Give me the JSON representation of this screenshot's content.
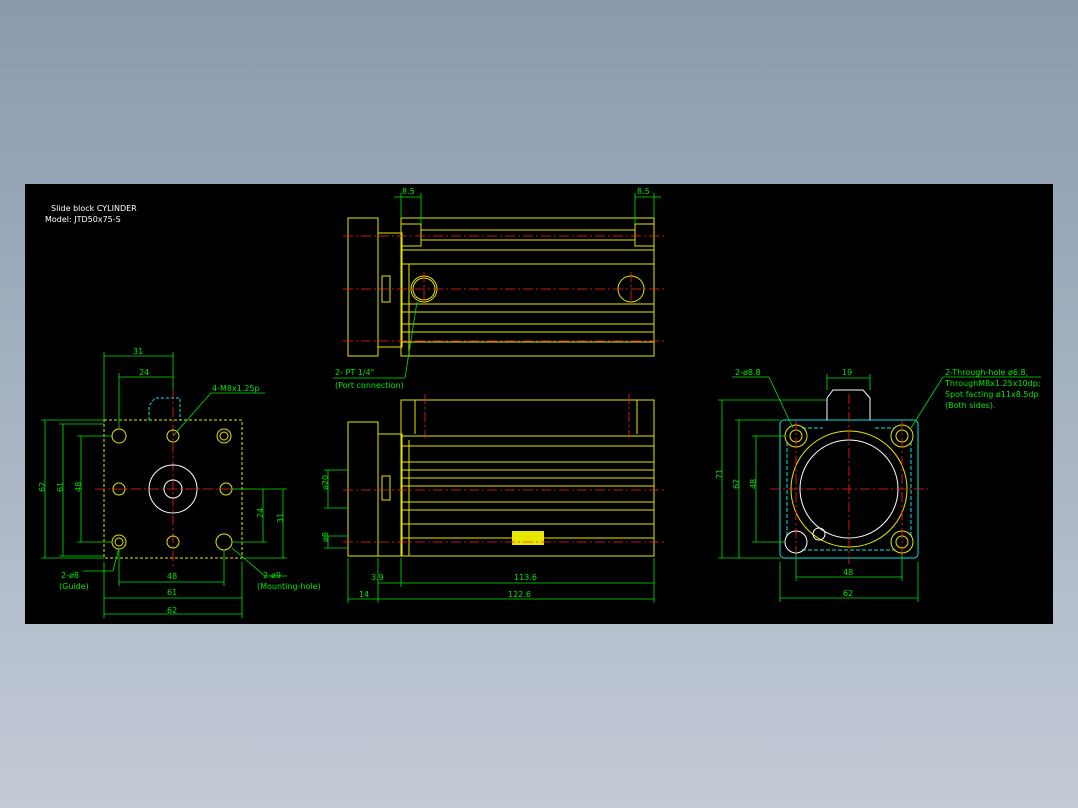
{
  "title_block": {
    "line1": "Slide block CYLINDER",
    "line2": "Model: JTD50x75-S"
  },
  "colors": {
    "background": "#000000",
    "outline": "#e6e600",
    "hidden": "#00e6e6",
    "dimension": "#00e600",
    "center_line": "#ff2020",
    "text": "#ffffff",
    "desktop_top": "#8a9aad",
    "desktop_bottom": "#c3cbd6"
  },
  "left_view": {
    "dim_top_31": "31",
    "dim_top_24": "24",
    "callout_threads": "4-M8x1.25p",
    "dim_62": "62",
    "dim_61": "61",
    "dim_48": "48",
    "dim_24": "24",
    "dim_31": "31",
    "guide_callout": "2-ø8",
    "guide_label": "(Guide)",
    "mount_callout": "2-ø9",
    "mount_label": "(Mounting-hole)",
    "dim_bottom_48": "48",
    "dim_bottom_61": "61",
    "dim_bottom_62": "62"
  },
  "top_view": {
    "dim_85_left": "8.5",
    "dim_85_right": "8.5",
    "port_callout": "2- PT 1/4\"",
    "port_label": "(Port connection)"
  },
  "side_view": {
    "dim_phi20": "ø20",
    "dim_phi8": "ø8",
    "dim_39": "3.9",
    "dim_1136": "113.6",
    "dim_14": "14",
    "dim_1226": "122.6"
  },
  "end_view": {
    "hole_callout": "2-ø8.8",
    "dim_19": "19",
    "note_line1": "2-Through-hole ø6.8,",
    "note_line2": "ThroughM8x1.25x10dp;",
    "note_line3": "Spot facting ø11x8.5dp",
    "note_line4": "(Both sides).",
    "dim_71": "71",
    "dim_62": "62",
    "dim_48": "48",
    "dim_bottom_48": "48",
    "dim_bottom_62": "62"
  }
}
